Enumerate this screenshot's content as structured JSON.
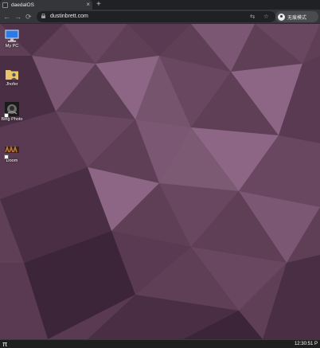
{
  "browser": {
    "tab": {
      "title": "daedalOS",
      "close_glyph": "×",
      "favicon": "daedalos-favicon-icon"
    },
    "new_tab_glyph": "+",
    "nav": {
      "back_glyph": "←",
      "forward_glyph": "→",
      "reload_glyph": "⟳"
    },
    "address": {
      "url": "dustinbrett.com"
    },
    "omnibox_icons": {
      "translate_glyph": "⇆",
      "star_glyph": "☆"
    },
    "profile": {
      "label": "无痕模式"
    }
  },
  "desktop": {
    "icons": [
      {
        "label": "My PC",
        "icon": "computer-icon"
      },
      {
        "label": "Jhofer",
        "icon": "user-folder-icon"
      },
      {
        "label": "Bing Photo",
        "icon": "bing-photo-icon",
        "shortcut": true
      },
      {
        "label": "Doom",
        "icon": "doom-icon",
        "shortcut": true
      }
    ],
    "wallpaper_colors": [
      "#4a2f44",
      "#5a3a52",
      "#6a4761",
      "#7c5774",
      "#8d6686",
      "#3c2538"
    ]
  },
  "taskbar": {
    "start_glyph": "π",
    "clock": "12:30:51 P"
  }
}
